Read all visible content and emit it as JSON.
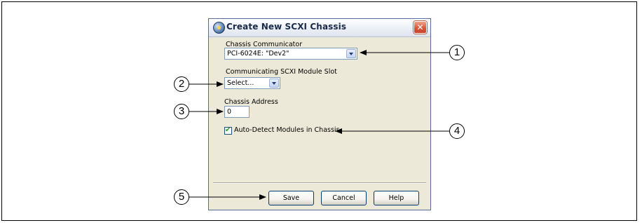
{
  "dialog": {
    "title": "Create New SCXI Chassis",
    "close_glyph": "✕",
    "chassis_communicator": {
      "label": "Chassis Communicator",
      "value": "PCI-6024E: \"Dev2\""
    },
    "module_slot": {
      "label": "Communicating SCXI Module Slot",
      "value": "Select..."
    },
    "chassis_address": {
      "label": "Chassis Address",
      "value": "0"
    },
    "auto_detect": {
      "label": "Auto-Detect Modules in Chassis",
      "checked": true
    },
    "buttons": {
      "save": "Save",
      "cancel": "Cancel",
      "help": "Help"
    }
  },
  "callouts": [
    "1",
    "2",
    "3",
    "4",
    "5"
  ],
  "icons": {
    "app": "scxi-app-icon",
    "close": "close-icon",
    "dropdown": "chevron-down-icon",
    "check": "checkmark-icon"
  }
}
